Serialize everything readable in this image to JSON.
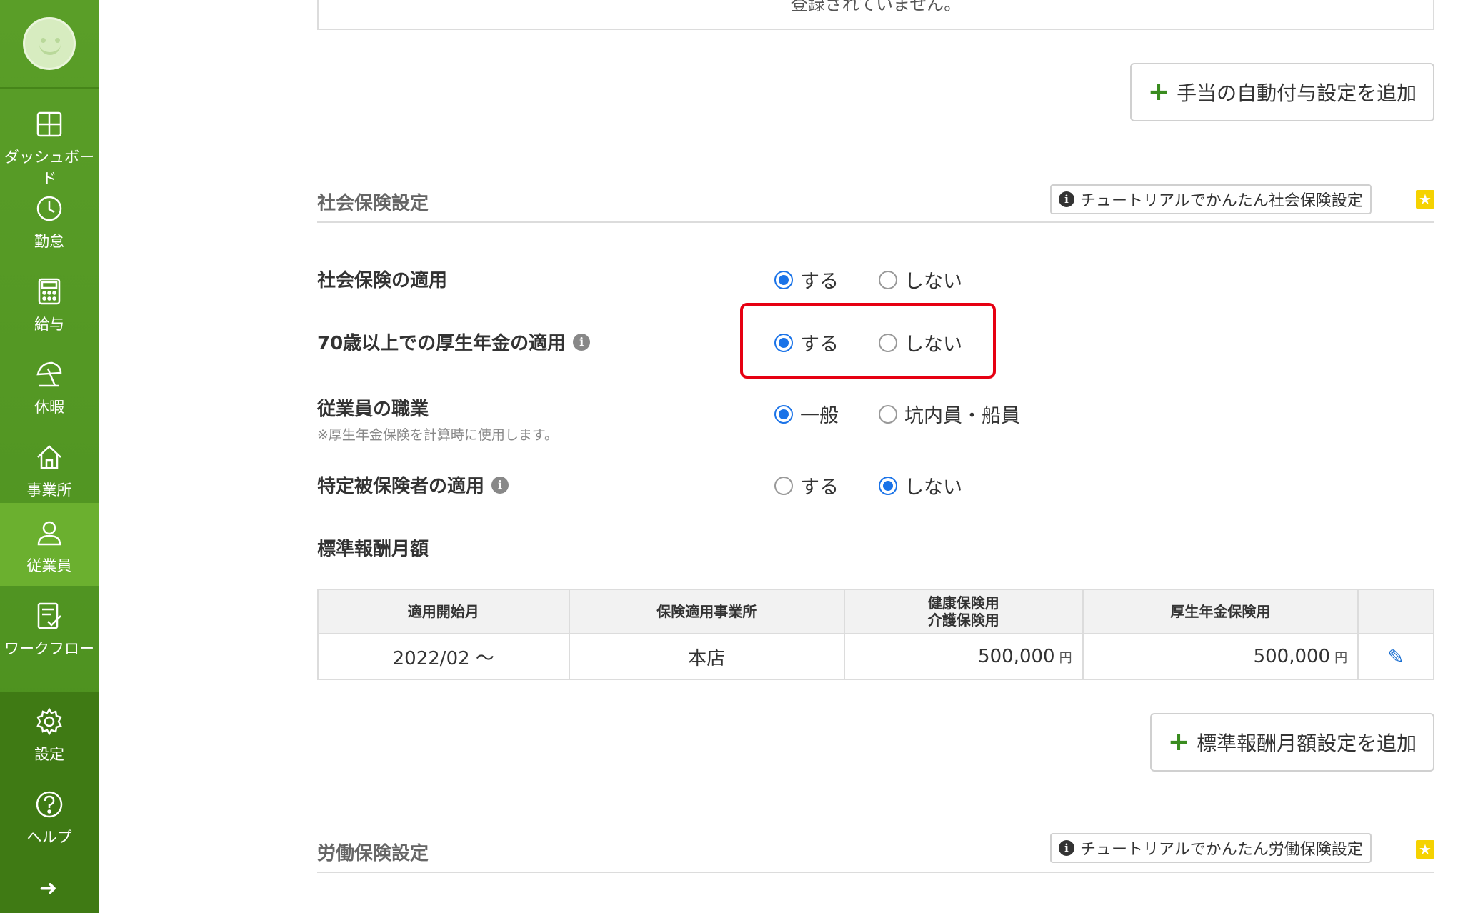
{
  "sidebar": {
    "items": [
      {
        "label": "ダッシュボード",
        "icon": "dashboard-icon"
      },
      {
        "label": "勤怠",
        "icon": "clock-icon"
      },
      {
        "label": "給与",
        "icon": "calculator-icon"
      },
      {
        "label": "休暇",
        "icon": "beach-umbrella-icon"
      },
      {
        "label": "事業所",
        "icon": "house-icon"
      },
      {
        "label": "従業員",
        "icon": "person-icon",
        "active": true
      },
      {
        "label": "ワークフロー",
        "icon": "checklist-icon"
      },
      {
        "label": "設定",
        "icon": "gear-icon"
      },
      {
        "label": "ヘルプ",
        "icon": "question-icon"
      }
    ],
    "expand_arrow": "➜"
  },
  "top_notice": "登録されていません。",
  "allowance_button": "手当の自動付与設定を追加",
  "social": {
    "title": "社会保険設定",
    "tutorial_button": "チュートリアルでかんたん社会保険設定",
    "rows": [
      {
        "label": "社会保険の適用",
        "options": [
          "する",
          "しない"
        ],
        "selected": 0
      },
      {
        "label": "70歳以上での厚生年金の適用",
        "options": [
          "する",
          "しない"
        ],
        "selected": 0
      },
      {
        "label": "従業員の職業",
        "note": "※厚生年金保険を計算時に使用します。",
        "options": [
          "一般",
          "坑内員・船員"
        ],
        "selected": 0
      },
      {
        "label": "特定被保険者の適用",
        "options": [
          "する",
          "しない"
        ],
        "selected": 1
      }
    ]
  },
  "salary": {
    "title": "標準報酬月額",
    "headers": [
      "適用開始月",
      "保険適用事業所",
      "健康保険用",
      "介護保険用",
      "厚生年金保険用"
    ],
    "row": {
      "start": "2022/02 〜",
      "office": "本店",
      "health": "500,000",
      "pension": "500,000",
      "yen": "円"
    },
    "add_button": "標準報酬月額設定を追加"
  },
  "labor": {
    "title": "労働保険設定",
    "tutorial_button": "チュートリアルでかんたん労働保険設定"
  },
  "colors": {
    "sidebar": "#5a9e28",
    "accent": "#1a73e8",
    "highlight": "#e60012",
    "plus": "#3a8c1f"
  }
}
